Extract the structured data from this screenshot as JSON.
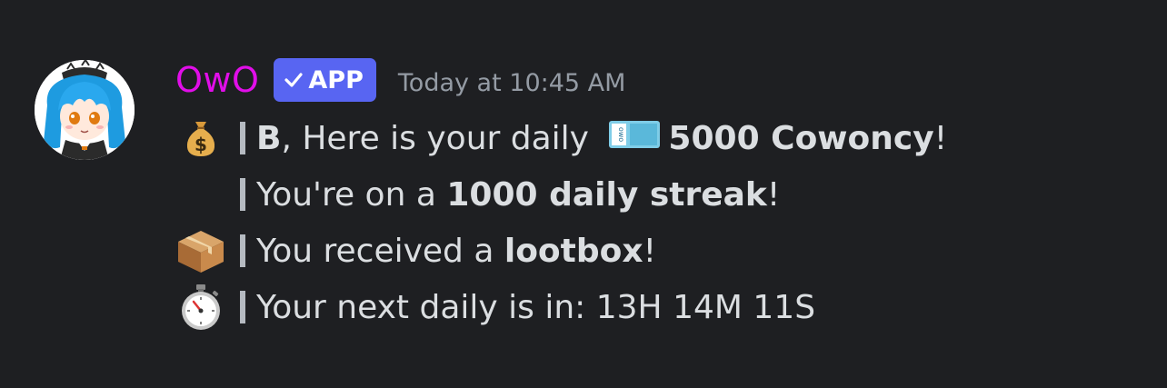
{
  "message": {
    "author": {
      "username": "OwO",
      "username_color": "#e10ee9",
      "badge_label": "APP",
      "badge_icon": "check-icon",
      "badge_color": "#5865f2",
      "avatar": "anime-maid-avatar"
    },
    "timestamp": "Today at 10:45 AM",
    "lines": [
      {
        "emoji": "money-bag-icon",
        "parts": [
          {
            "text": "B",
            "bold": true
          },
          {
            "text": ", Here is your daily ",
            "bold": false
          },
          {
            "icon": "cowoncy-icon"
          },
          {
            "text": "5000 Cowoncy",
            "bold": true
          },
          {
            "text": "!",
            "bold": false
          }
        ]
      },
      {
        "emoji": "",
        "parts": [
          {
            "text": "You're on a ",
            "bold": false
          },
          {
            "text": "1000 daily streak",
            "bold": true
          },
          {
            "text": "!",
            "bold": false
          }
        ]
      },
      {
        "emoji": "package-icon",
        "parts": [
          {
            "text": "You received a ",
            "bold": false
          },
          {
            "text": "lootbox",
            "bold": true
          },
          {
            "text": "!",
            "bold": false
          }
        ]
      },
      {
        "emoji": "stopwatch-icon",
        "parts": [
          {
            "text": "Your next daily is in: 13H 14M 11S",
            "bold": false
          }
        ]
      }
    ]
  }
}
